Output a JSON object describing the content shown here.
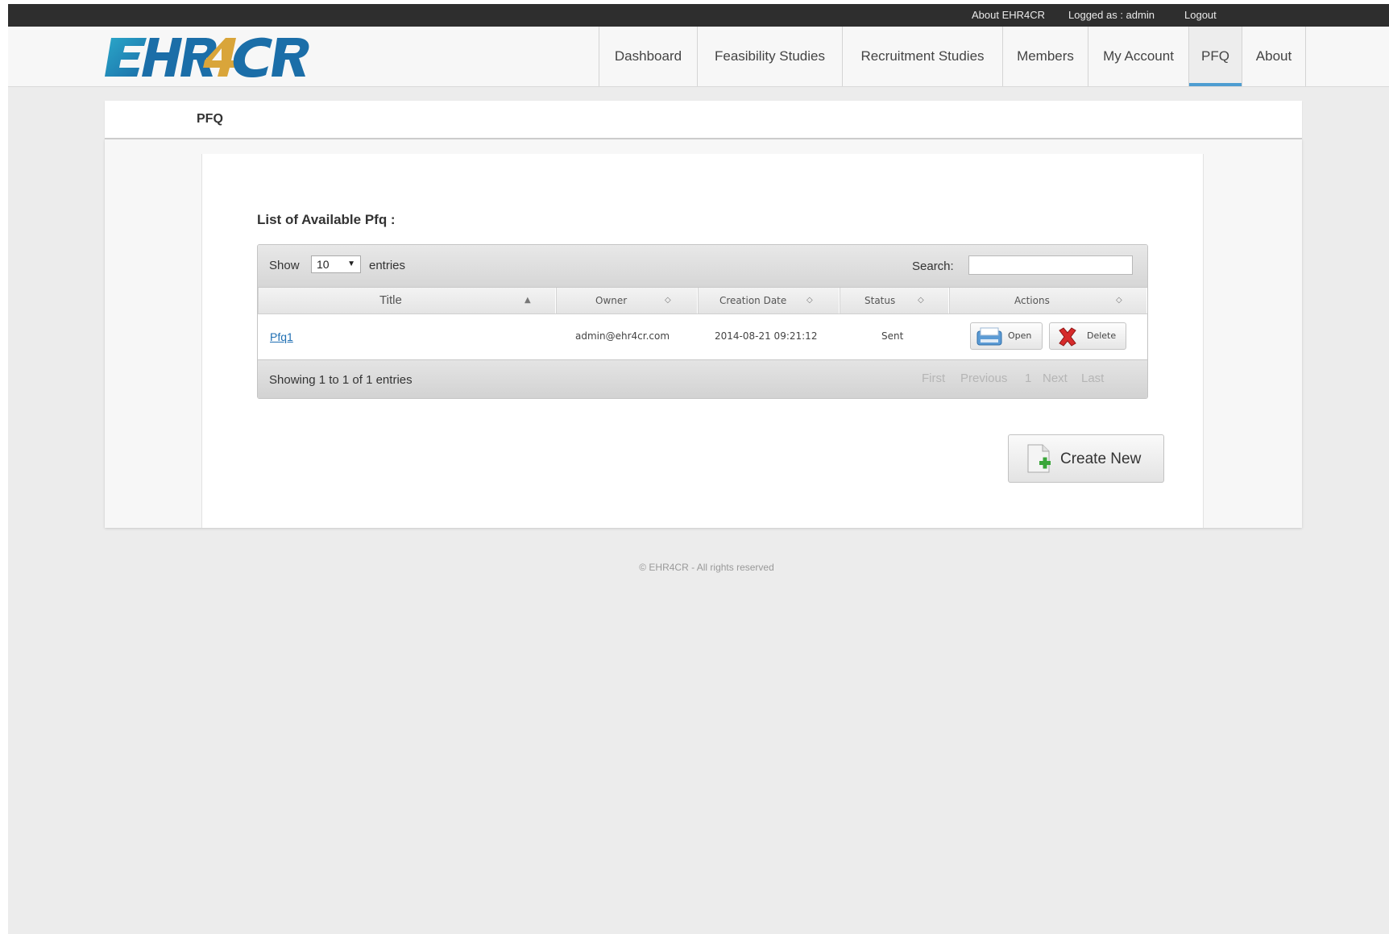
{
  "topbar": {
    "about_label": "About EHR4CR",
    "logged_label": "Logged as : admin",
    "logout_label": "Logout"
  },
  "logo": {
    "text": "EHR4CR"
  },
  "nav": {
    "items": [
      {
        "label": "Dashboard"
      },
      {
        "label": "Feasibility Studies"
      },
      {
        "label": "Recruitment Studies"
      },
      {
        "label": "Members"
      },
      {
        "label": "My Account"
      },
      {
        "label": "PFQ",
        "active": true
      },
      {
        "label": "About"
      }
    ]
  },
  "page": {
    "title": "PFQ",
    "list_title": "List of Available Pfq :"
  },
  "table": {
    "show_label": "Show",
    "length_value": "10",
    "entries_label": "entries",
    "search_label": "Search:",
    "search_value": "",
    "columns": [
      "Title",
      "Owner",
      "Creation Date",
      "Status",
      "Actions"
    ],
    "rows": [
      {
        "title": "Pfq1",
        "owner": "admin@ehr4cr.com",
        "creation_date": "2014-08-21 09:21:12",
        "status": "Sent",
        "open_label": "Open",
        "delete_label": "Delete"
      }
    ],
    "info": "Showing 1 to 1 of 1 entries",
    "pagination": {
      "first": "First",
      "previous": "Previous",
      "page": "1",
      "next": "Next",
      "last": "Last"
    }
  },
  "create_new_label": "Create New",
  "footer": "© EHR4CR - All rights reserved",
  "colors": {
    "accent": "#4e9dd1",
    "link": "#1f6fb3",
    "topbar": "#2e2e2e",
    "logo_blue": "#1b6ea8",
    "logo_teal": "#2aa7c9",
    "logo_gold": "#d9a53a"
  }
}
